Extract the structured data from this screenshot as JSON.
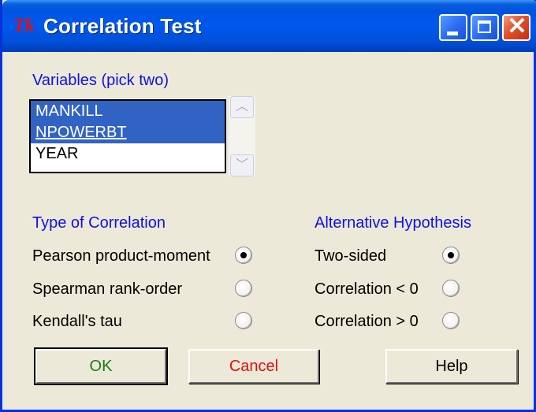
{
  "window": {
    "icon": "Tk",
    "title": "Correlation Test",
    "controls": {
      "minimize": "minimize-icon",
      "maximize": "maximize-icon",
      "close": "close-icon"
    }
  },
  "variables": {
    "label": "Variables (pick two)",
    "items": [
      {
        "label": "MANKILL",
        "selected": true
      },
      {
        "label": "NPOWERBT",
        "selected": true
      },
      {
        "label": "YEAR",
        "selected": false
      }
    ]
  },
  "correlation_type": {
    "label": "Type of Correlation",
    "options": [
      {
        "label": "Pearson product-moment",
        "checked": true
      },
      {
        "label": "Spearman rank-order",
        "checked": false
      },
      {
        "label": "Kendall's tau",
        "checked": false
      }
    ]
  },
  "alternative": {
    "label": "Alternative Hypothesis",
    "options": [
      {
        "label": "Two-sided",
        "checked": true
      },
      {
        "label": "Correlation < 0",
        "checked": false
      },
      {
        "label": "Correlation > 0",
        "checked": false
      }
    ]
  },
  "buttons": {
    "ok": "OK",
    "cancel": "Cancel",
    "help": "Help"
  },
  "colors": {
    "section_label": "#1010e8",
    "ok_text": "#1a7a1a",
    "cancel_text": "#e01010",
    "selection": "#3163c5"
  }
}
